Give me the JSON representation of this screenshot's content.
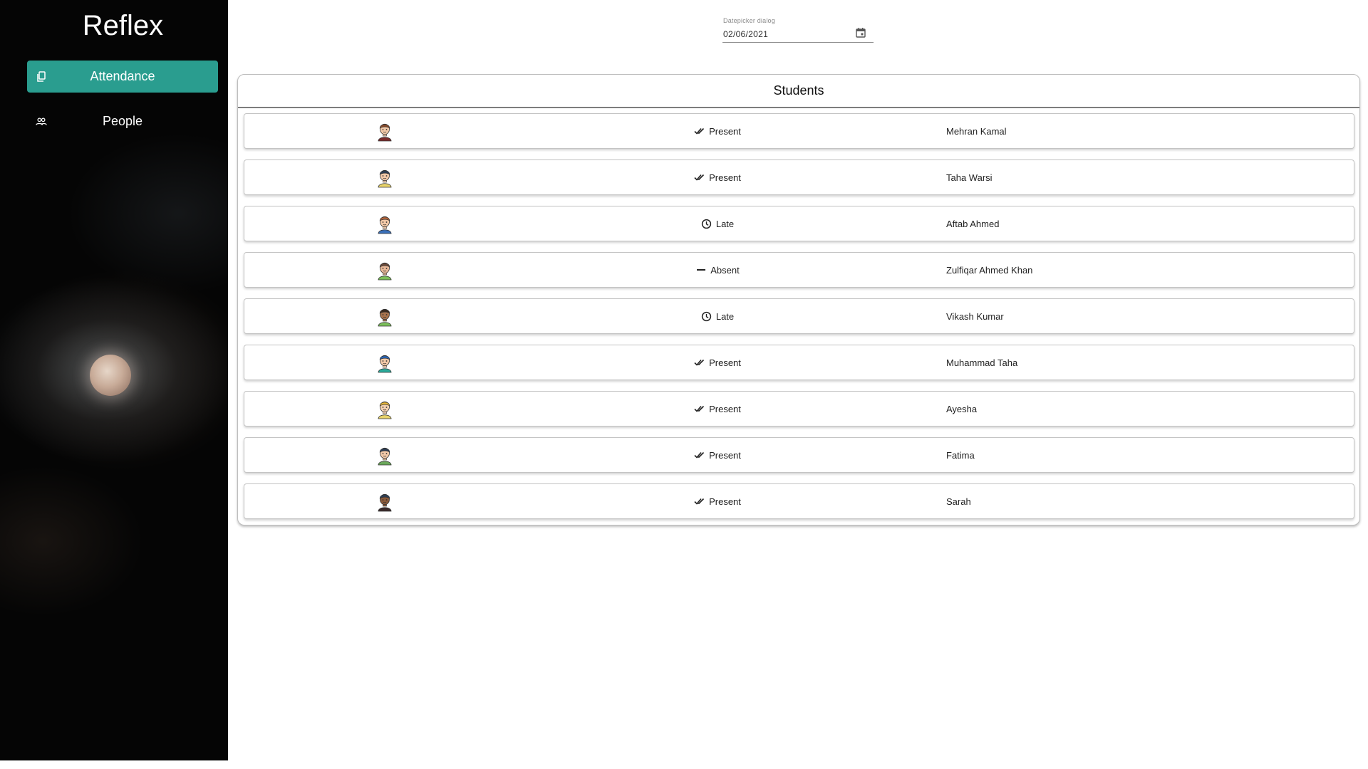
{
  "sidebar": {
    "brand": "Reflex",
    "items": [
      {
        "label": "Attendance",
        "icon": "clipboard-icon",
        "active": true
      },
      {
        "label": "People",
        "icon": "people-icon",
        "active": false
      }
    ],
    "accent_color": "#2a9d8f"
  },
  "datepicker": {
    "label": "Datepicker dialog",
    "value": "02/06/2021",
    "icon": "calendar-icon"
  },
  "students": {
    "title": "Students",
    "rows": [
      {
        "name": "Mehran Kamal",
        "status": "Present",
        "status_icon": "double-check-icon",
        "avatar": {
          "hair": "#8a4b2a",
          "skin": "#f2c9a8",
          "shirt": "#7a2a2a"
        }
      },
      {
        "name": "Taha Warsi",
        "status": "Present",
        "status_icon": "double-check-icon",
        "avatar": {
          "hair": "#2d3e55",
          "skin": "#f2c9a8",
          "shirt": "#e8d36a"
        }
      },
      {
        "name": "Aftab Ahmed",
        "status": "Late",
        "status_icon": "clock-icon",
        "avatar": {
          "hair": "#b5643a",
          "skin": "#f2c9a8",
          "shirt": "#3a6fb8"
        }
      },
      {
        "name": "Zulfiqar Ahmed Khan",
        "status": "Absent",
        "status_icon": "dash-icon",
        "avatar": {
          "hair": "#6b4a3a",
          "skin": "#e8b898",
          "shirt": "#7bbf5a"
        }
      },
      {
        "name": "Vikash Kumar",
        "status": "Late",
        "status_icon": "clock-icon",
        "avatar": {
          "hair": "#3a2a1e",
          "skin": "#a8744e",
          "shirt": "#7bbf5a"
        }
      },
      {
        "name": "Muhammad Taha",
        "status": "Present",
        "status_icon": "double-check-icon",
        "avatar": {
          "hair": "#2a66b8",
          "skin": "#f2c9a8",
          "shirt": "#2aaa9a"
        }
      },
      {
        "name": "Ayesha",
        "status": "Present",
        "status_icon": "double-check-icon",
        "avatar": {
          "hair": "#e8b83a",
          "skin": "#f2d0b0",
          "shirt": "#e8d36a"
        }
      },
      {
        "name": "Fatima",
        "status": "Present",
        "status_icon": "double-check-icon",
        "avatar": {
          "hair": "#2d3e55",
          "skin": "#f2c9a8",
          "shirt": "#6aa85a"
        }
      },
      {
        "name": "Sarah",
        "status": "Present",
        "status_icon": "double-check-icon",
        "avatar": {
          "hair": "#2d3e55",
          "skin": "#8a5a3a",
          "shirt": "#3a2a2a"
        }
      }
    ]
  }
}
